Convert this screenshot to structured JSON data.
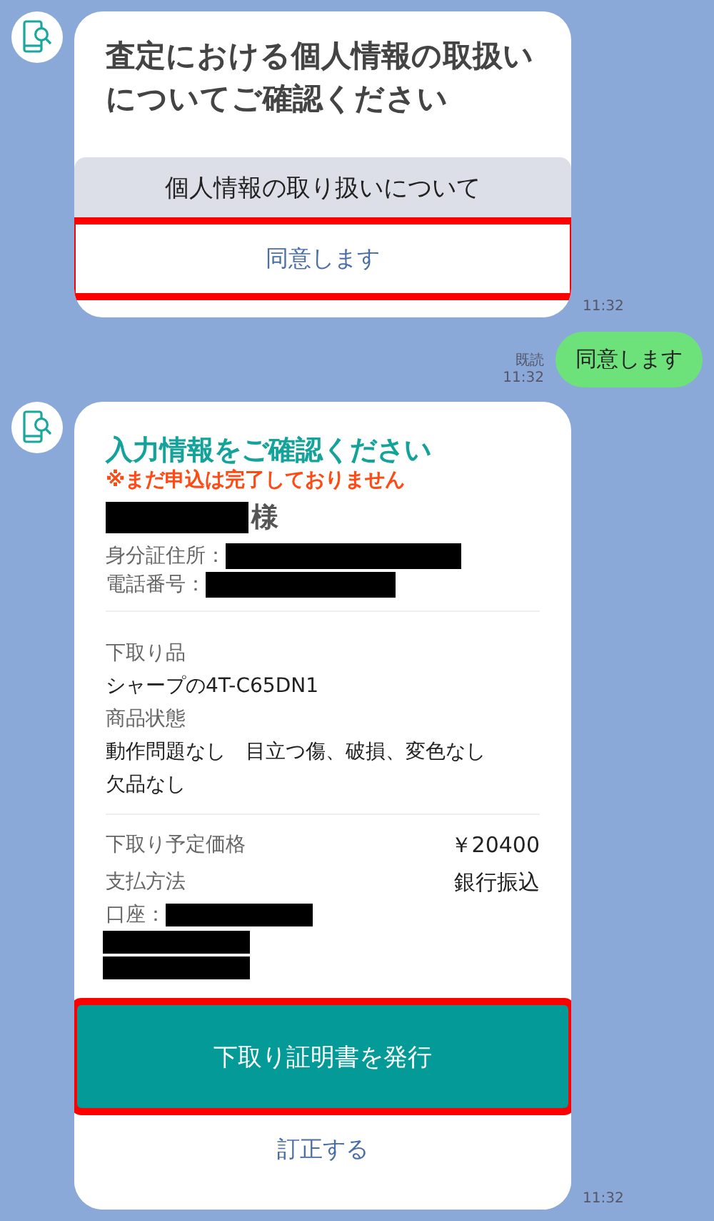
{
  "messages": [
    {
      "kind": "bot",
      "title": "査定における個人情報の取扱いについてご確認ください",
      "actions": [
        {
          "kind": "secondary",
          "label": "個人情報の取り扱いについて",
          "highlighted": false
        },
        {
          "kind": "link",
          "label": "同意します",
          "highlighted": true
        }
      ],
      "time": "11:32"
    },
    {
      "kind": "user",
      "text": "同意します",
      "read": "既読",
      "time": "11:32"
    },
    {
      "kind": "bot",
      "title": "入力情報をご確認ください",
      "warning": "※まだ申込は完了しておりません",
      "name": {
        "redacted": true,
        "honorific": "様"
      },
      "contact": [
        {
          "label": "身分証住所：",
          "redacted": true
        },
        {
          "label": "電話番号：",
          "redacted": true
        }
      ],
      "details": [
        {
          "label": "下取り品",
          "lines": [
            "シャープの4T-C65DN1"
          ]
        },
        {
          "label": "商品状態",
          "lines": [
            "動作問題なし　目立つ傷、破損、変色なし",
            "欠品なし"
          ]
        }
      ],
      "payment": [
        {
          "label": "下取り予定価格",
          "value": "￥20400"
        },
        {
          "label": "支払方法",
          "value": "銀行振込"
        }
      ],
      "account": {
        "label": "口座：",
        "redacted": true,
        "extra_lines": [
          {
            "redacted": true
          },
          {
            "redacted": true
          }
        ]
      },
      "actions": [
        {
          "kind": "primary",
          "label": "下取り証明書を発行",
          "highlighted": true
        },
        {
          "kind": "link",
          "label": "訂正する",
          "highlighted": false
        }
      ],
      "time": "11:32"
    }
  ]
}
